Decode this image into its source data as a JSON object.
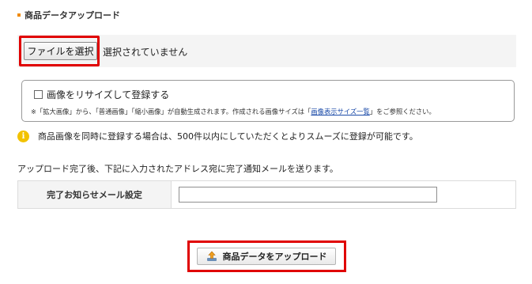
{
  "section": {
    "title": "商品データアップロード"
  },
  "file_input": {
    "button_label": "ファイルを選択",
    "status": "選択されていません"
  },
  "resize": {
    "checkbox_label": "画像をリサイズして登録する",
    "checked": false,
    "note_before": "※「拡大画像」から、「普通画像」「縮小画像」が自動生成されます。作成される画像サイズは「",
    "note_link": "画像表示サイズ一覧",
    "note_after": "」をご参照ください。"
  },
  "info": {
    "icon": "info-icon",
    "text": "商品画像を同時に登録する場合は、500件以内にしていただくとよりスムーズに登録が可能です。"
  },
  "mail": {
    "note": "アップロード完了後、下記に入力されたアドレス宛に完了通知メールを送ります。",
    "label": "完了お知らせメール設定",
    "value": ""
  },
  "upload": {
    "button_label": "商品データをアップロード",
    "icon": "upload-icon"
  },
  "colors": {
    "highlight": "#e00000",
    "accent": "#f08a00",
    "info": "#f2c200",
    "link": "#1a4aa8"
  }
}
